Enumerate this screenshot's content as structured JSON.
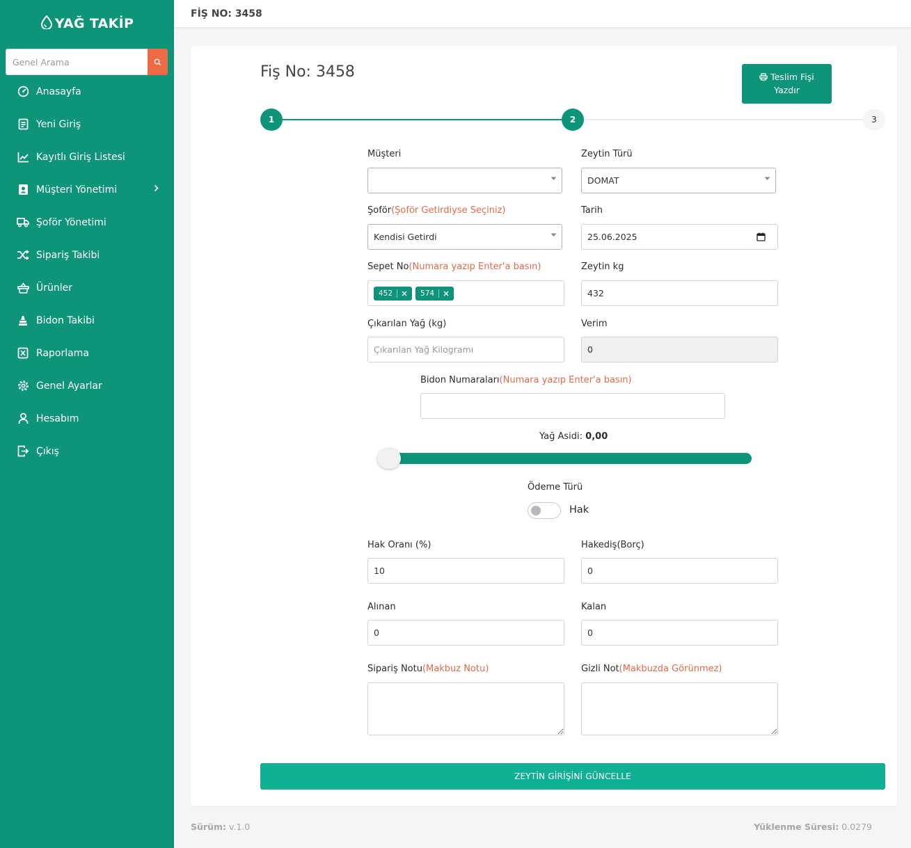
{
  "app": {
    "logo_text": "YAĞ TAKİP"
  },
  "sidebar": {
    "search_placeholder": "Genel Arama",
    "items": [
      {
        "label": "Anasayfa",
        "icon": "dashboard-icon"
      },
      {
        "label": "Yeni Giriş",
        "icon": "document-icon"
      },
      {
        "label": "Kayıtlı Giriş Listesi",
        "icon": "chart-line-icon"
      },
      {
        "label": "Müşteri Yönetimi",
        "icon": "contact-icon"
      },
      {
        "label": "Şoför Yönetimi",
        "icon": "truck-icon"
      },
      {
        "label": "Sipariş Takibi",
        "icon": "shuffle-icon"
      },
      {
        "label": "Ürünler",
        "icon": "basket-icon"
      },
      {
        "label": "Bidon Takibi",
        "icon": "stack-icon"
      },
      {
        "label": "Raporlama",
        "icon": "excel-icon"
      },
      {
        "label": "Genel Ayarlar",
        "icon": "gear-icon"
      },
      {
        "label": "Hesabım",
        "icon": "user-icon"
      },
      {
        "label": "Çıkış",
        "icon": "logout-icon"
      }
    ]
  },
  "topbar": {
    "title": "FİŞ NO: 3458"
  },
  "card": {
    "title": "Fiş No: 3458",
    "print_button": {
      "line1": "Teslim Fişi",
      "line2": "Yazdır"
    }
  },
  "stepper": {
    "steps": [
      "1",
      "2",
      "3"
    ],
    "current_step": 2
  },
  "form": {
    "musteri": {
      "label": "Müşteri",
      "value": ""
    },
    "zeytin_turu": {
      "label": "Zeytin Türü",
      "value": "DOMAT"
    },
    "sofor": {
      "label": "Şoför",
      "hint": "(Şoför Getirdiyse Seçiniz)",
      "value": "Kendisi Getirdi"
    },
    "tarih": {
      "label": "Tarih",
      "value": "25.06.2025"
    },
    "sepet_no": {
      "label": "Sepet No",
      "hint": "(Numara yazıp Enter'a basın)",
      "tags": [
        "452",
        "574"
      ]
    },
    "zeytin_kg": {
      "label": "Zeytin kg",
      "value": "432"
    },
    "cikarilan_yag": {
      "label": "Çıkarılan Yağ (kg)",
      "placeholder": "Çıkarılan Yağ Kilogramı",
      "value": ""
    },
    "verim": {
      "label": "Verim",
      "value": "0"
    },
    "bidon_numaralari": {
      "label": "Bidon Numaraları",
      "hint": "(Numara yazıp Enter'a basın)",
      "value": ""
    },
    "yag_asidi": {
      "label": "Yağ Asidi:",
      "value": "0,00",
      "slider_fraction": 0
    },
    "odeme_turu": {
      "label": "Ödeme Türü",
      "toggle_label": "Hak",
      "checked": false
    },
    "hak_orani": {
      "label": "Hak Oranı (%)",
      "value": "10"
    },
    "hakedis": {
      "label": "Hakediş(Borç)",
      "value": "0"
    },
    "alinan": {
      "label": "Alınan",
      "value": "0"
    },
    "kalan": {
      "label": "Kalan",
      "value": "0"
    },
    "siparis_notu": {
      "label": "Sipariş Notu",
      "hint": "(Makbuz Notu)",
      "value": ""
    },
    "gizli_not": {
      "label": "Gizli Not",
      "hint": "(Makbuzda Görünmez)",
      "value": ""
    },
    "submit_label": "ZEYTİN GİRİŞİNİ GÜNCELLE"
  },
  "footer": {
    "version_label": "Sürüm:",
    "version_value": "v.1.0",
    "load_label": "Yüklenme Süresi:",
    "load_value": "0.0279"
  },
  "colors": {
    "primary": "#0d9479",
    "accent": "#ee6a45",
    "hint": "#e36a4a",
    "submit": "#10b094"
  }
}
